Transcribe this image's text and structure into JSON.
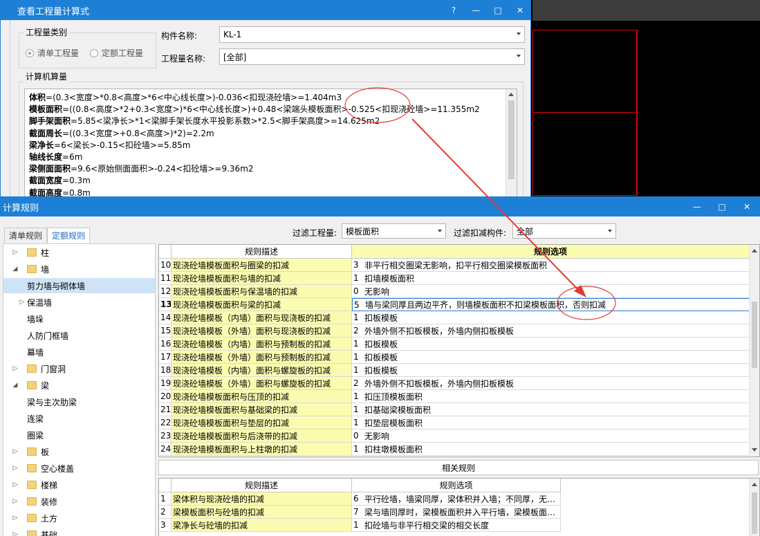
{
  "dialog_formula": {
    "title": "查看工程量计算式",
    "window_buttons": [
      "?",
      "—",
      "□",
      "✕"
    ],
    "qty_category": {
      "label": "工程量类别",
      "options": [
        {
          "label": "清单工程量",
          "checked": true
        },
        {
          "label": "定额工程量",
          "checked": false
        }
      ]
    },
    "component_name": {
      "label": "构件名称:",
      "value": "KL-1"
    },
    "qty_name": {
      "label": "工程量名称:",
      "value": "[全部]"
    },
    "computer_calc_label": "计算机算量",
    "formula_lines": [
      {
        "name": "体积",
        "expr": "=(0.3<宽度>*0.8<高度>*6<中心线长度>)-0.036<扣现浇砼墙>=1.404m3"
      },
      {
        "name": "模板面积",
        "expr": "=((0.8<高度>*2+0.3<宽度>)*6<中心线长度>)+0.48<梁端头模板面积>-0.525<扣现浇砼墙>=11.355m2"
      },
      {
        "name": "脚手架面积",
        "expr": "=5.85<梁净长>*1<梁脚手架长度水平投影系数>*2.5<脚手架高度>=14.625m2"
      },
      {
        "name": "截面周长",
        "expr": "=((0.3<宽度>+0.8<高度>)*2)=2.2m"
      },
      {
        "name": "梁净长",
        "expr": "=6<梁长>-0.15<扣砼墙>=5.85m"
      },
      {
        "name": "轴线长度",
        "expr": "=6m"
      },
      {
        "name": "梁侧面面积",
        "expr": "=9.6<原始侧面面积>-0.24<扣砼墙>=9.36m2"
      },
      {
        "name": "截面宽度",
        "expr": "=0.3m"
      },
      {
        "name": "截面高度",
        "expr": "=0.8m"
      }
    ]
  },
  "dialog_rules": {
    "title": "计算规则",
    "window_buttons": [
      "—",
      "□",
      "✕"
    ],
    "tabs": [
      {
        "label": "清单规则",
        "active": false
      },
      {
        "label": "定额规则",
        "active": true
      }
    ],
    "filter_qty": {
      "label": "过滤工程量:",
      "value": "模板面积"
    },
    "filter_deduct": {
      "label": "过滤扣减构件:",
      "value": "全部"
    },
    "tree": [
      {
        "label": "柱",
        "level": 0,
        "toggle": "▷",
        "folder": true,
        "selected": false
      },
      {
        "label": "墙",
        "level": 0,
        "toggle": "◢",
        "folder": true,
        "selected": false
      },
      {
        "label": "剪力墙与砌体墙",
        "level": 1,
        "toggle": "",
        "folder": false,
        "selected": true
      },
      {
        "label": "保温墙",
        "level": 1,
        "toggle": "▷",
        "folder": false,
        "selected": false
      },
      {
        "label": "墙垛",
        "level": 1,
        "toggle": "",
        "folder": false,
        "selected": false
      },
      {
        "label": "人防门框墙",
        "level": 1,
        "toggle": "",
        "folder": false,
        "selected": false
      },
      {
        "label": "幕墙",
        "level": 1,
        "toggle": "",
        "folder": false,
        "selected": false
      },
      {
        "label": "门窗洞",
        "level": 0,
        "toggle": "▷",
        "folder": true,
        "selected": false
      },
      {
        "label": "梁",
        "level": 0,
        "toggle": "◢",
        "folder": true,
        "selected": false
      },
      {
        "label": "梁与主次肋梁",
        "level": 1,
        "toggle": "",
        "folder": false,
        "selected": false
      },
      {
        "label": "连梁",
        "level": 1,
        "toggle": "",
        "folder": false,
        "selected": false
      },
      {
        "label": "圈梁",
        "level": 1,
        "toggle": "",
        "folder": false,
        "selected": false
      },
      {
        "label": "板",
        "level": 0,
        "toggle": "▷",
        "folder": true,
        "selected": false
      },
      {
        "label": "空心楼盖",
        "level": 0,
        "toggle": "▷",
        "folder": true,
        "selected": false
      },
      {
        "label": "楼梯",
        "level": 0,
        "toggle": "▷",
        "folder": true,
        "selected": false
      },
      {
        "label": "装修",
        "level": 0,
        "toggle": "▷",
        "folder": true,
        "selected": false
      },
      {
        "label": "土方",
        "level": 0,
        "toggle": "▷",
        "folder": true,
        "selected": false
      },
      {
        "label": "基础",
        "level": 0,
        "toggle": "▷",
        "folder": true,
        "selected": false
      }
    ],
    "rules_grid": {
      "headers": [
        "规则描述",
        "规则选项"
      ],
      "rows": [
        {
          "no": "10",
          "desc": "现浇砼墙模板面积与圈梁的扣减",
          "code": "3",
          "option": "非平行相交圈梁无影响，扣平行相交圈梁模板面积",
          "current": false
        },
        {
          "no": "11",
          "desc": "现浇砼墙模板面积与墙的扣减",
          "code": "1",
          "option": "扣墙模板面积",
          "current": false
        },
        {
          "no": "12",
          "desc": "现浇砼墙模板面积与保温墙的扣减",
          "code": "0",
          "option": "无影响",
          "current": false
        },
        {
          "no": "13",
          "desc": "现浇砼墙模板面积与梁的扣减",
          "code": "5",
          "option": "墙与梁同厚且两边平齐，则墙模板面积不扣梁模板面积，否则扣减",
          "current": true
        },
        {
          "no": "14",
          "desc": "现浇砼墙模板（内墙）面积与现浇板的扣减",
          "code": "1",
          "option": "扣板模板",
          "current": false
        },
        {
          "no": "15",
          "desc": "现浇砼墙模板（外墙）面积与现浇板的扣减",
          "code": "2",
          "option": "外墙外侧不扣板模板，外墙内侧扣板模板",
          "current": false
        },
        {
          "no": "16",
          "desc": "现浇砼墙模板（内墙）面积与预制板的扣减",
          "code": "1",
          "option": "扣板模板",
          "current": false
        },
        {
          "no": "17",
          "desc": "现浇砼墙模板（外墙）面积与预制板的扣减",
          "code": "1",
          "option": "扣板模板",
          "current": false
        },
        {
          "no": "18",
          "desc": "现浇砼墙模板（内墙）面积与螺旋板的扣减",
          "code": "1",
          "option": "扣板模板",
          "current": false
        },
        {
          "no": "19",
          "desc": "现浇砼墙模板（外墙）面积与螺旋板的扣减",
          "code": "2",
          "option": "外墙外侧不扣板模板，外墙内侧扣板模板",
          "current": false
        },
        {
          "no": "20",
          "desc": "现浇砼墙模板面积与压顶的扣减",
          "code": "1",
          "option": "扣压顶模板面积",
          "current": false
        },
        {
          "no": "21",
          "desc": "现浇砼墙模板面积与基础梁的扣减",
          "code": "1",
          "option": "扣基础梁模板面积",
          "current": false
        },
        {
          "no": "22",
          "desc": "现浇砼墙模板面积与垫层的扣减",
          "code": "1",
          "option": "扣垫层模板面积",
          "current": false
        },
        {
          "no": "23",
          "desc": "现浇砼墙模板面积与后浇带的扣减",
          "code": "0",
          "option": "无影响",
          "current": false
        },
        {
          "no": "24",
          "desc": "现浇砼墙模板面积与上柱墩的扣减",
          "code": "1",
          "option": "扣柱墩模板面积",
          "current": false
        }
      ]
    },
    "related_label": "相关规则",
    "related_grid": {
      "headers": [
        "规则描述",
        "规则选项"
      ],
      "rows": [
        {
          "no": "1",
          "desc": "梁体积与现浇砼墙的扣减",
          "code": "6",
          "option": "平行砼墙，墙梁同厚，梁体积并入墙；不同厚，无…"
        },
        {
          "no": "2",
          "desc": "梁模板面积与砼墙的扣减",
          "code": "7",
          "option": "梁与墙同厚时，梁模板面积并入平行墙，梁模板面…"
        },
        {
          "no": "3",
          "desc": "梁净长与砼墙的扣减",
          "code": "1",
          "option": "扣砼墙与非平行相交梁的相交长度"
        }
      ]
    }
  }
}
